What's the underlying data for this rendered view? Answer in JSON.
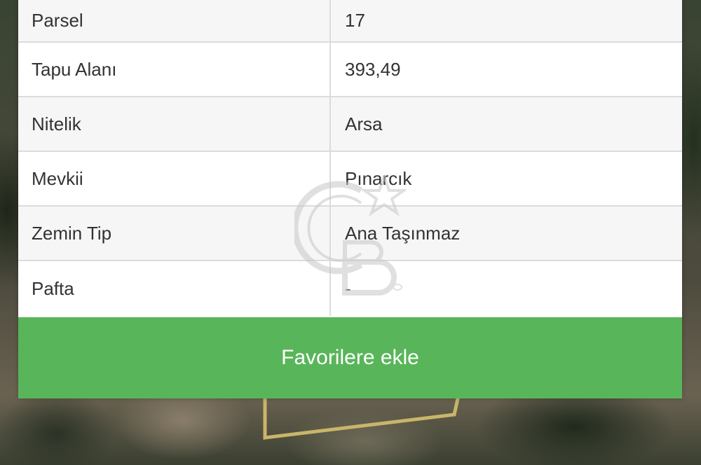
{
  "table": {
    "rows": [
      {
        "label": "Parsel",
        "value": "17"
      },
      {
        "label": "Tapu Alanı",
        "value": "393,49"
      },
      {
        "label": "Nitelik",
        "value": "Arsa"
      },
      {
        "label": "Mevkii",
        "value": "Pınarcık"
      },
      {
        "label": "Zemin Tip",
        "value": "Ana Taşınmaz"
      },
      {
        "label": "Pafta",
        "value": "-"
      }
    ]
  },
  "actions": {
    "favorite_label": "Favorilere ekle"
  },
  "colors": {
    "button_green": "#59b55a",
    "row_alt": "#f6f6f6",
    "parcel_outline": "#c9b56a"
  },
  "watermark": {
    "icon": "cb-logo-icon",
    "text": "CB"
  }
}
